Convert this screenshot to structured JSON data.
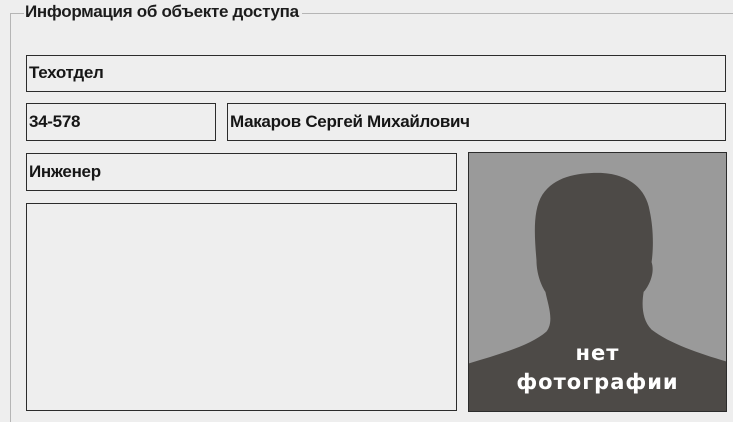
{
  "group": {
    "title": "Информация об объекте доступа"
  },
  "fields": {
    "department": "Техотдел",
    "personnel_number": "34-578",
    "full_name": "Макаров Сергей Михайлович",
    "position": "Инженер",
    "notes": ""
  },
  "photo": {
    "placeholder_line1": "нет",
    "placeholder_line2": "фотографии",
    "icon": "person-silhouette-icon"
  },
  "colors": {
    "background": "#eeeeee",
    "field_border": "#2c2c2c",
    "photo_background": "#9a9a9a",
    "silhouette": "#4d4a47",
    "caption": "#ffffff"
  }
}
